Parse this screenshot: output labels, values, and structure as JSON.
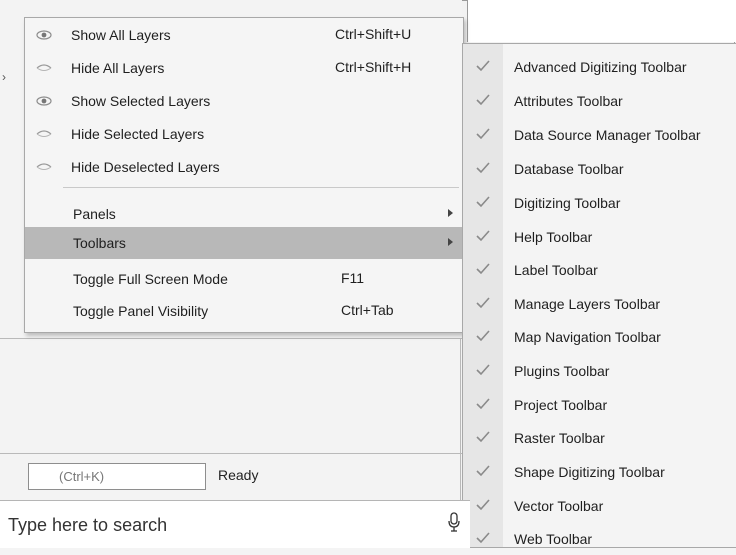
{
  "view_menu": {
    "items": [
      {
        "label": "Show All Layers",
        "shortcut": "Ctrl+Shift+U",
        "icon": "eye-open-icon"
      },
      {
        "label": "Hide All Layers",
        "shortcut": "Ctrl+Shift+H",
        "icon": "eye-closed-icon"
      },
      {
        "label": "Show Selected Layers",
        "shortcut": "",
        "icon": "eye-open-icon"
      },
      {
        "label": "Hide Selected Layers",
        "shortcut": "",
        "icon": "eye-closed-icon"
      },
      {
        "label": "Hide Deselected Layers",
        "shortcut": "",
        "icon": "eye-closed-icon"
      },
      {
        "label": "Panels",
        "shortcut": "",
        "submenu": true
      },
      {
        "label": "Toolbars",
        "shortcut": "",
        "submenu": true,
        "highlighted": true
      },
      {
        "label": "Toggle Full Screen Mode",
        "shortcut": "F11"
      },
      {
        "label": "Toggle Panel Visibility",
        "shortcut": "Ctrl+Tab"
      }
    ]
  },
  "toolbars_submenu": {
    "items": [
      {
        "label": "Advanced Digitizing Toolbar",
        "checked": true
      },
      {
        "label": "Attributes Toolbar",
        "checked": true
      },
      {
        "label": "Data Source Manager Toolbar",
        "checked": true
      },
      {
        "label": "Database Toolbar",
        "checked": true
      },
      {
        "label": "Digitizing Toolbar",
        "checked": true
      },
      {
        "label": "Help Toolbar",
        "checked": true
      },
      {
        "label": "Label Toolbar",
        "checked": true
      },
      {
        "label": "Manage Layers Toolbar",
        "checked": true
      },
      {
        "label": "Map Navigation Toolbar",
        "checked": true
      },
      {
        "label": "Plugins Toolbar",
        "checked": true
      },
      {
        "label": "Project Toolbar",
        "checked": true
      },
      {
        "label": "Raster Toolbar",
        "checked": true
      },
      {
        "label": "Shape Digitizing Toolbar",
        "checked": true
      },
      {
        "label": "Vector Toolbar",
        "checked": true
      },
      {
        "label": "Web Toolbar",
        "checked": true
      }
    ]
  },
  "status_bar": {
    "locator_placeholder": "(Ctrl+K)",
    "status_text": "Ready"
  },
  "taskbar": {
    "search_placeholder": "Type here to search",
    "mic_icon": "microphone-icon"
  },
  "colors": {
    "highlight": "#b8b8b8",
    "check": "#8a8a8a"
  }
}
